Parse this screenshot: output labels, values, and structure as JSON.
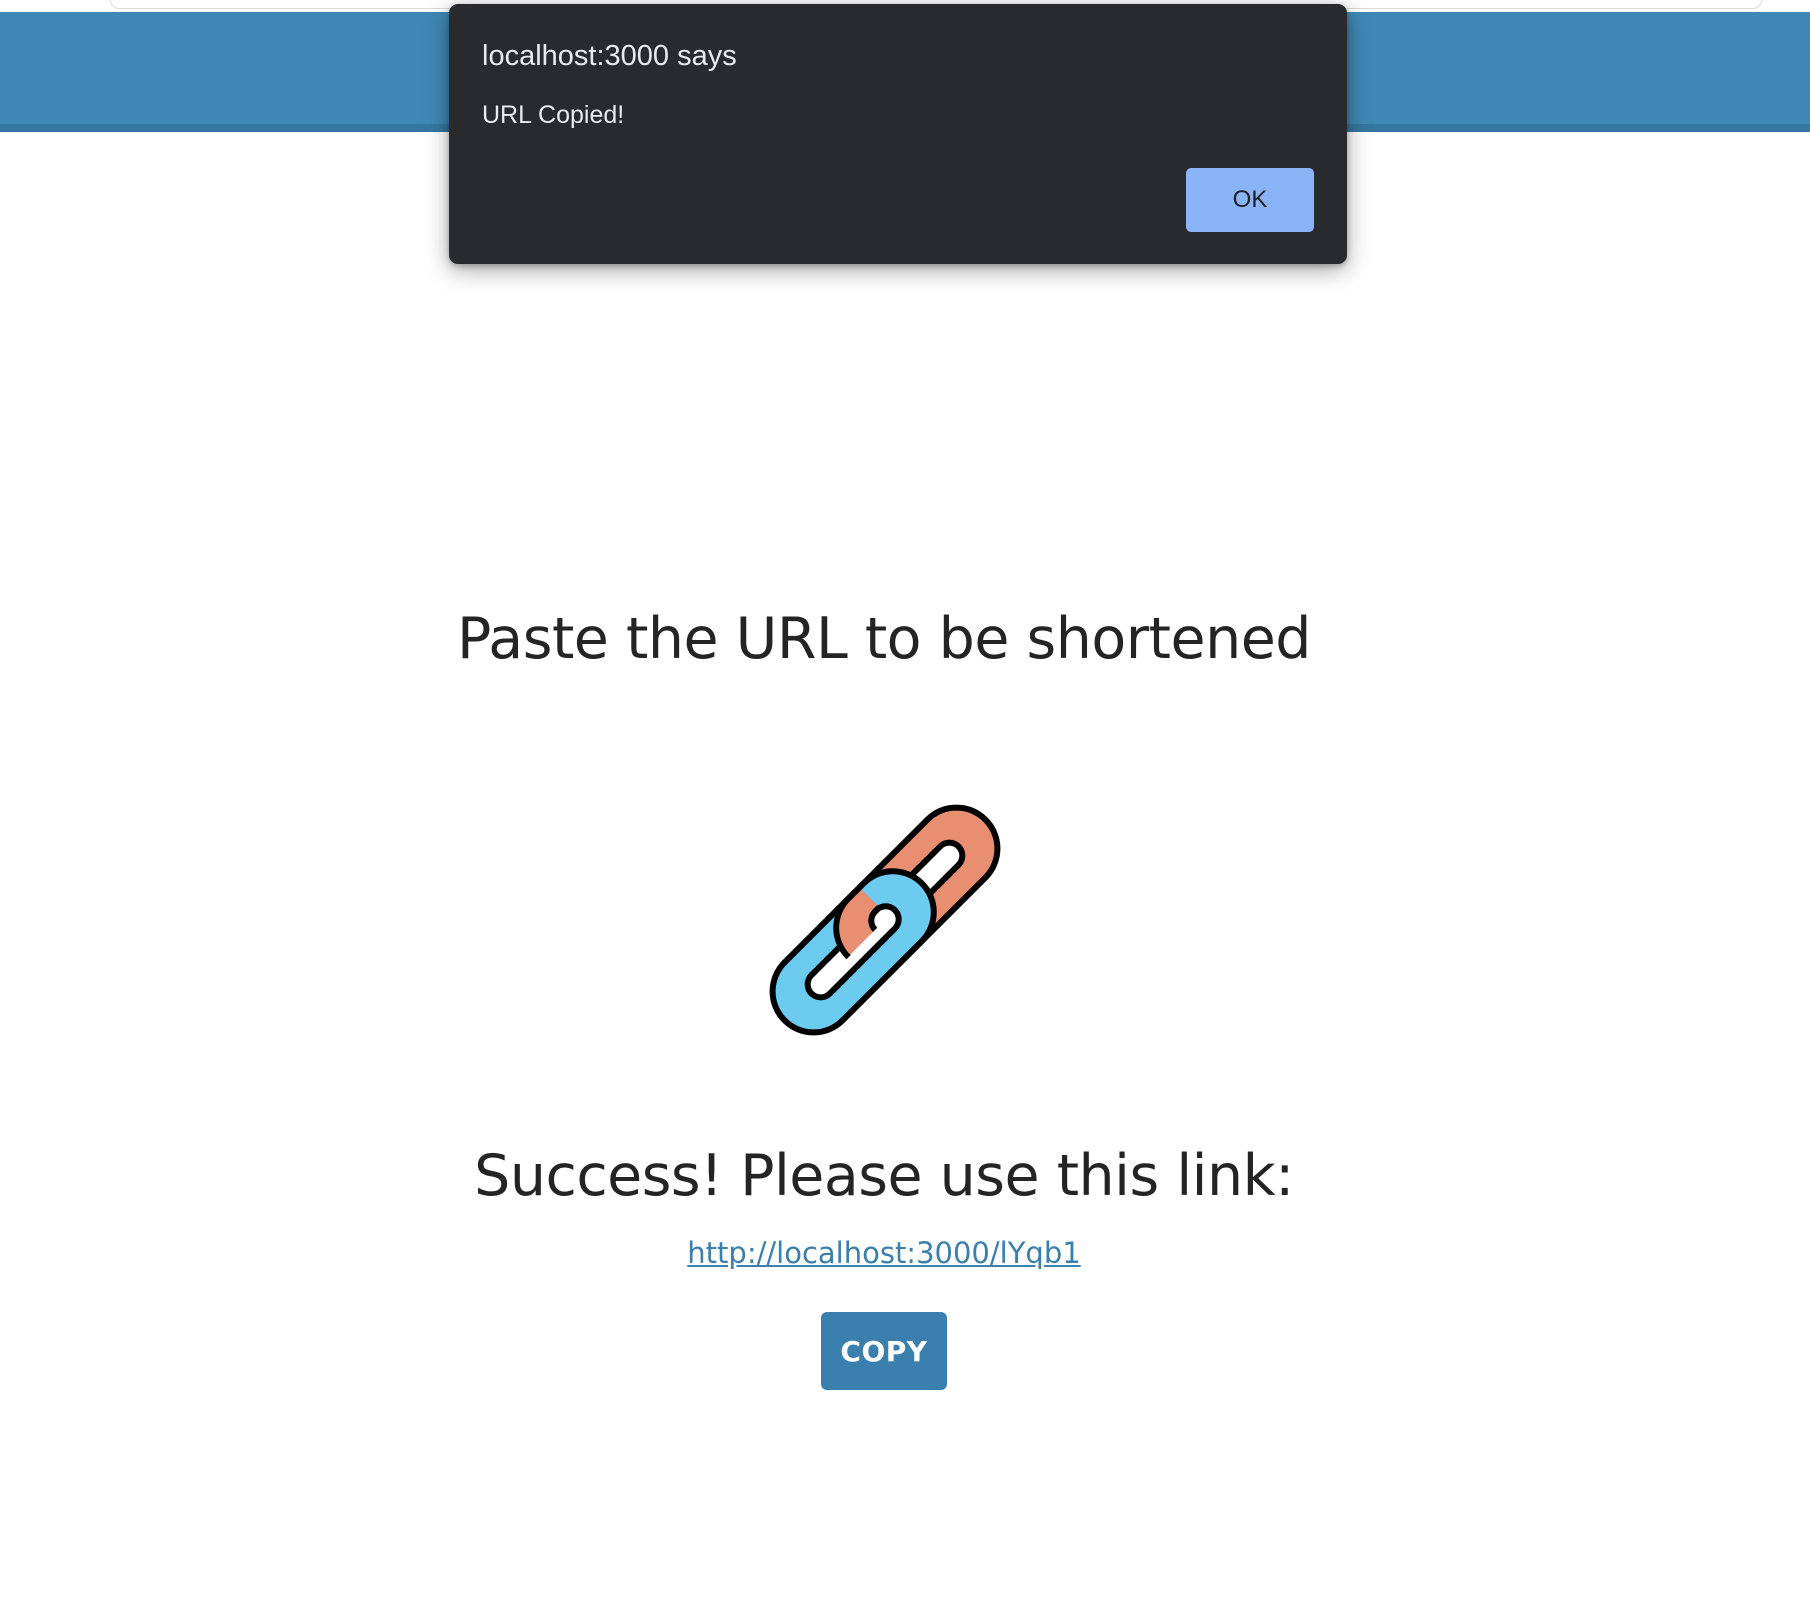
{
  "alert": {
    "title": "localhost:3000 says",
    "message": "URL Copied!",
    "ok_label": "OK"
  },
  "main": {
    "heading": "Paste the URL to be shortened",
    "success_text": "Success! Please use this link:",
    "short_url": "http://localhost:3000/lYqb1",
    "copy_label": "COPY"
  },
  "icons": {
    "logo": "chain-link-icon"
  },
  "colors": {
    "header_bar": "#3f88b5",
    "accent": "#3a7fad",
    "alert_background": "#292a2d",
    "alert_button": "#8ab4f8",
    "chain_orange": "#e98f71",
    "chain_blue": "#6ccbef"
  }
}
